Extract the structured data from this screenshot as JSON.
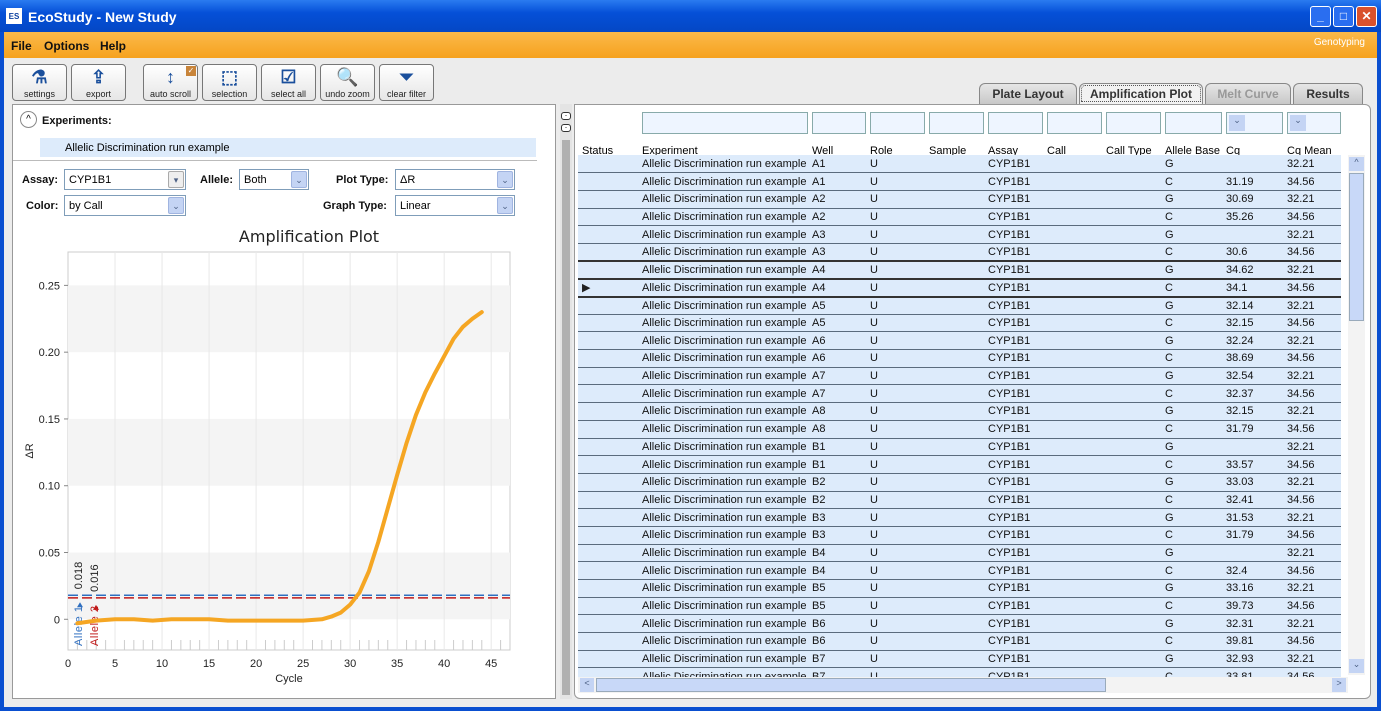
{
  "window": {
    "title": "EcoStudy - New Study",
    "logo": "ES"
  },
  "menu": {
    "items": [
      "File",
      "Options",
      "Help"
    ],
    "mode": "Genotyping"
  },
  "toolbar": [
    {
      "label": "settings",
      "icon": "flask-icon"
    },
    {
      "label": "export",
      "icon": "export-icon"
    },
    {
      "label": "auto scroll",
      "icon": "auto-scroll-icon",
      "checked": true
    },
    {
      "label": "selection",
      "icon": "selection-icon"
    },
    {
      "label": "select all",
      "icon": "select-all-icon"
    },
    {
      "label": "undo zoom",
      "icon": "undo-zoom-icon"
    },
    {
      "label": "clear filter",
      "icon": "clear-filter-icon"
    }
  ],
  "experiments": {
    "title": "Experiments:",
    "item": "Allelic Discrimination run example"
  },
  "controls": {
    "assay_label": "Assay:",
    "assay": "CYP1B1",
    "allele_label": "Allele:",
    "allele": "Both",
    "plot_type_label": "Plot Type:",
    "plot_type": "ΔR",
    "color_label": "Color:",
    "color": "by Call",
    "graph_type_label": "Graph Type:",
    "graph_type": "Linear"
  },
  "tabs": [
    {
      "label": "Plate Layout"
    },
    {
      "label": "Amplification Plot",
      "active": true
    },
    {
      "label": "Melt Curve",
      "disabled": true
    },
    {
      "label": "Results"
    }
  ],
  "chart_data": {
    "type": "line",
    "title": "Amplification Plot",
    "xlabel": "Cycle",
    "ylabel": "ΔR",
    "xlim": [
      0,
      47
    ],
    "ylim": [
      -0.023,
      0.275
    ],
    "xticks": [
      0,
      5,
      10,
      15,
      20,
      25,
      30,
      35,
      40,
      45
    ],
    "yticks": [
      0,
      0.05,
      0.1,
      0.15,
      0.2,
      0.25
    ],
    "ytick_labels": [
      "0",
      "0.05",
      "0.10",
      "0.15",
      "0.20",
      "0.25"
    ],
    "series": [
      {
        "color": "#f5a623",
        "x": [
          1,
          3,
          5,
          7,
          9,
          11,
          13,
          15,
          17,
          19,
          21,
          23,
          25,
          27,
          28,
          29,
          30,
          31,
          32,
          33,
          34,
          35,
          36,
          37,
          38,
          39,
          40,
          41,
          42,
          43,
          44
        ],
        "y": [
          -0.003,
          -0.001,
          0,
          0,
          -0.001,
          0,
          0,
          0,
          -0.001,
          -0.001,
          -0.001,
          -0.001,
          -0.001,
          0,
          0.002,
          0.005,
          0.011,
          0.02,
          0.036,
          0.058,
          0.083,
          0.108,
          0.132,
          0.153,
          0.17,
          0.184,
          0.197,
          0.21,
          0.219,
          0.225,
          0.23
        ]
      }
    ],
    "thresholds": [
      {
        "label": "Allele 1",
        "value": 0.018,
        "value_label": "0.018",
        "color": "#2f6fc0"
      },
      {
        "label": "Allele 2",
        "value": 0.016,
        "value_label": "0.016",
        "color": "#c01818"
      }
    ],
    "grid": true
  },
  "table": {
    "columns": [
      "Status",
      "Experiment",
      "Well",
      "Role",
      "Sample",
      "Assay",
      "Call",
      "Call Type",
      "Allele Base",
      "Cq",
      "Cq Mean"
    ],
    "rows": [
      [
        "",
        "Allelic Discrimination run example",
        "A1",
        "U",
        "",
        "CYP1B1",
        "",
        "",
        "G",
        "",
        "32.21"
      ],
      [
        "",
        "Allelic Discrimination run example",
        "A1",
        "U",
        "",
        "CYP1B1",
        "",
        "",
        "C",
        "31.19",
        "34.56"
      ],
      [
        "",
        "Allelic Discrimination run example",
        "A2",
        "U",
        "",
        "CYP1B1",
        "",
        "",
        "G",
        "30.69",
        "32.21"
      ],
      [
        "",
        "Allelic Discrimination run example",
        "A2",
        "U",
        "",
        "CYP1B1",
        "",
        "",
        "C",
        "35.26",
        "34.56"
      ],
      [
        "",
        "Allelic Discrimination run example",
        "A3",
        "U",
        "",
        "CYP1B1",
        "",
        "",
        "G",
        "",
        "32.21"
      ],
      [
        "",
        "Allelic Discrimination run example",
        "A3",
        "U",
        "",
        "CYP1B1",
        "",
        "",
        "C",
        "30.6",
        "34.56"
      ],
      [
        "",
        "Allelic Discrimination run example",
        "A4",
        "U",
        "",
        "CYP1B1",
        "",
        "",
        "G",
        "34.62",
        "32.21"
      ],
      [
        "",
        "Allelic Discrimination run example",
        "A4",
        "U",
        "",
        "CYP1B1",
        "",
        "",
        "C",
        "34.1",
        "34.56"
      ],
      [
        "",
        "Allelic Discrimination run example",
        "A5",
        "U",
        "",
        "CYP1B1",
        "",
        "",
        "G",
        "32.14",
        "32.21"
      ],
      [
        "",
        "Allelic Discrimination run example",
        "A5",
        "U",
        "",
        "CYP1B1",
        "",
        "",
        "C",
        "32.15",
        "34.56"
      ],
      [
        "",
        "Allelic Discrimination run example",
        "A6",
        "U",
        "",
        "CYP1B1",
        "",
        "",
        "G",
        "32.24",
        "32.21"
      ],
      [
        "",
        "Allelic Discrimination run example",
        "A6",
        "U",
        "",
        "CYP1B1",
        "",
        "",
        "C",
        "38.69",
        "34.56"
      ],
      [
        "",
        "Allelic Discrimination run example",
        "A7",
        "U",
        "",
        "CYP1B1",
        "",
        "",
        "G",
        "32.54",
        "32.21"
      ],
      [
        "",
        "Allelic Discrimination run example",
        "A7",
        "U",
        "",
        "CYP1B1",
        "",
        "",
        "C",
        "32.37",
        "34.56"
      ],
      [
        "",
        "Allelic Discrimination run example",
        "A8",
        "U",
        "",
        "CYP1B1",
        "",
        "",
        "G",
        "32.15",
        "32.21"
      ],
      [
        "",
        "Allelic Discrimination run example",
        "A8",
        "U",
        "",
        "CYP1B1",
        "",
        "",
        "C",
        "31.79",
        "34.56"
      ],
      [
        "",
        "Allelic Discrimination run example",
        "B1",
        "U",
        "",
        "CYP1B1",
        "",
        "",
        "G",
        "",
        "32.21"
      ],
      [
        "",
        "Allelic Discrimination run example",
        "B1",
        "U",
        "",
        "CYP1B1",
        "",
        "",
        "C",
        "33.57",
        "34.56"
      ],
      [
        "",
        "Allelic Discrimination run example",
        "B2",
        "U",
        "",
        "CYP1B1",
        "",
        "",
        "G",
        "33.03",
        "32.21"
      ],
      [
        "",
        "Allelic Discrimination run example",
        "B2",
        "U",
        "",
        "CYP1B1",
        "",
        "",
        "C",
        "32.41",
        "34.56"
      ],
      [
        "",
        "Allelic Discrimination run example",
        "B3",
        "U",
        "",
        "CYP1B1",
        "",
        "",
        "G",
        "31.53",
        "32.21"
      ],
      [
        "",
        "Allelic Discrimination run example",
        "B3",
        "U",
        "",
        "CYP1B1",
        "",
        "",
        "C",
        "31.79",
        "34.56"
      ],
      [
        "",
        "Allelic Discrimination run example",
        "B4",
        "U",
        "",
        "CYP1B1",
        "",
        "",
        "G",
        "",
        "32.21"
      ],
      [
        "",
        "Allelic Discrimination run example",
        "B4",
        "U",
        "",
        "CYP1B1",
        "",
        "",
        "C",
        "32.4",
        "34.56"
      ],
      [
        "",
        "Allelic Discrimination run example",
        "B5",
        "U",
        "",
        "CYP1B1",
        "",
        "",
        "G",
        "33.16",
        "32.21"
      ],
      [
        "",
        "Allelic Discrimination run example",
        "B5",
        "U",
        "",
        "CYP1B1",
        "",
        "",
        "C",
        "39.73",
        "34.56"
      ],
      [
        "",
        "Allelic Discrimination run example",
        "B6",
        "U",
        "",
        "CYP1B1",
        "",
        "",
        "G",
        "32.31",
        "32.21"
      ],
      [
        "",
        "Allelic Discrimination run example",
        "B6",
        "U",
        "",
        "CYP1B1",
        "",
        "",
        "C",
        "39.81",
        "34.56"
      ],
      [
        "",
        "Allelic Discrimination run example",
        "B7",
        "U",
        "",
        "CYP1B1",
        "",
        "",
        "G",
        "32.93",
        "32.21"
      ],
      [
        "",
        "Allelic Discrimination run example",
        "B7",
        "U",
        "",
        "CYP1B1",
        "",
        "",
        "C",
        "33.81",
        "34.56"
      ]
    ],
    "selected_rows": [
      6,
      7
    ],
    "current_row": 7
  }
}
